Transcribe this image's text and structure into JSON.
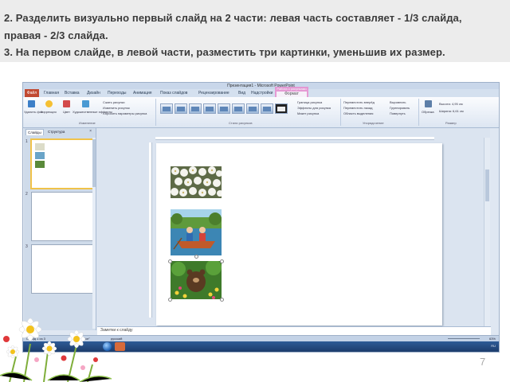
{
  "instructions": {
    "line1": "2. Разделить визуально первый слайд на 2 части: левая часть составляет - 1/3 слайда,",
    "line2": "правая - 2/3 слайда.",
    "line3": "3. На первом слайде, в левой части, разместить три картинки, уменьшив их размер."
  },
  "ppt": {
    "titlebar": "Презентация1 - Microsoft PowerPoint",
    "tabs": [
      "Файл",
      "Главная",
      "Вставка",
      "Дизайн",
      "Переходы",
      "Анимация",
      "Показ слайдов",
      "Рецензирование",
      "Вид",
      "Надстройки"
    ],
    "context_tab": {
      "group": "Работа с рисунками",
      "label": "Формат"
    },
    "ribbon": {
      "adjust_group": "Изменение",
      "styles_group": "Стили рисунков",
      "arrange_group": "Упорядочение",
      "size_group": "Размер",
      "adjust_items": [
        "Удалить фон",
        "Коррекция",
        "Цвет",
        "Художественные эффекты"
      ],
      "adjust_right": [
        "Сжать рисунки",
        "Изменить рисунок",
        "Сбросить параметры рисунка"
      ],
      "style_right": [
        "Граница рисунка",
        "Эффекты для рисунка",
        "Макет рисунка"
      ],
      "arrange_items": [
        "Переместить вперёд",
        "Переместить назад",
        "Область выделения"
      ],
      "arrange_right": [
        "Выровнять",
        "Группировать",
        "Повернуть"
      ],
      "crop": "Обрезка",
      "height": "Высота: 4,95 см",
      "width": "Ширина: 6,61 см"
    },
    "panel_tabs": {
      "slides": "Слайды",
      "outline": "Структура"
    },
    "slide_numbers": [
      "1",
      "2",
      "3"
    ],
    "notes_placeholder": "Заметки к слайду",
    "status": {
      "slide": "Слайд 1 из 3",
      "theme": "\"Тема Office\"",
      "lang": "русский",
      "zoom": "63%"
    },
    "tray_time": "RU"
  },
  "page_number": "7",
  "colors": {
    "file_tab": "#c14a32",
    "context_tab": "#e88ed0",
    "selection": "#f0c24a",
    "taskbar": "#1f4a82"
  }
}
